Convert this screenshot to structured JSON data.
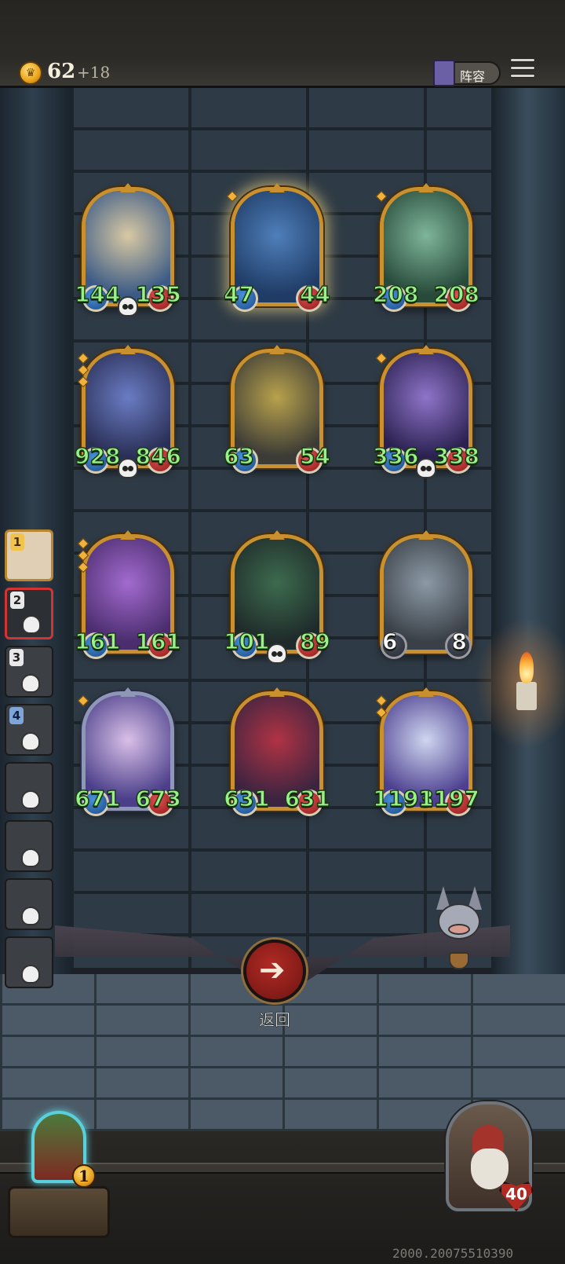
{
  "header": {
    "coin_count": "62",
    "coin_bonus": "+18",
    "lineup_label": "阵容"
  },
  "board": {
    "cards": [
      {
        "name": "king",
        "atk": "144",
        "hp": "135",
        "frame": "gold",
        "skull": true,
        "pips": 0,
        "art": [
          "#3b5a86",
          "#d8c9a3"
        ]
      },
      {
        "name": "jester-elf",
        "atk": "47",
        "hp": "44",
        "frame": "gold",
        "skull": false,
        "pips": 1,
        "selected": true,
        "art": [
          "#1f3c66",
          "#4f7fba"
        ]
      },
      {
        "name": "flute-maiden",
        "atk": "208",
        "hp": "208",
        "frame": "gold",
        "skull": false,
        "pips": 1,
        "art": [
          "#274a3a",
          "#7fb59a"
        ]
      },
      {
        "name": "blue-hair-sorceress",
        "atk": "928",
        "hp": "846",
        "frame": "gold",
        "skull": true,
        "pips": 3,
        "art": [
          "#2a2f55",
          "#6a7cc4"
        ]
      },
      {
        "name": "robot",
        "atk": "63",
        "hp": "54",
        "frame": "gold",
        "skull": false,
        "pips": 0,
        "art": [
          "#3c3b36",
          "#b8a24c"
        ]
      },
      {
        "name": "moon-witch",
        "atk": "336",
        "hp": "338",
        "frame": "gold",
        "skull": true,
        "pips": 1,
        "art": [
          "#2a2150",
          "#8f74c9"
        ]
      },
      {
        "name": "airship",
        "atk": "161",
        "hp": "161",
        "frame": "gold",
        "skull": false,
        "pips": 3,
        "art": [
          "#4b2d6e",
          "#a26bcf"
        ]
      },
      {
        "name": "tentacle-creature",
        "atk": "101",
        "hp": "89",
        "frame": "gold",
        "skull": true,
        "pips": 0,
        "art": [
          "#1f2a2a",
          "#3d6b4e"
        ]
      },
      {
        "name": "horned-beast",
        "atk": "6",
        "hp": "8",
        "frame": "gold",
        "skull": false,
        "pips": 0,
        "dark_badges": true,
        "white_stats": true,
        "art": [
          "#3a4047",
          "#8c9aa6"
        ]
      },
      {
        "name": "flower-fairy",
        "atk": "671",
        "hp": "673",
        "frame": "silver",
        "skull": false,
        "pips": 1,
        "art": [
          "#4b3f8a",
          "#d9c0e8"
        ]
      },
      {
        "name": "clown",
        "atk": "631",
        "hp": "631",
        "frame": "gold",
        "skull": false,
        "pips": 0,
        "art": [
          "#3b2440",
          "#b03344"
        ]
      },
      {
        "name": "snow-maiden",
        "atk": "1193",
        "hp": "1197",
        "frame": "gold",
        "skull": false,
        "pips": 2,
        "art": [
          "#4c3f8f",
          "#cfd6f0"
        ]
      }
    ]
  },
  "queue": {
    "slots": [
      {
        "number": "1",
        "style": "gold"
      },
      {
        "number": "2",
        "style": "red"
      },
      {
        "number": "3",
        "style": "plain"
      },
      {
        "number": "4",
        "style": "blue"
      },
      {
        "number": "",
        "style": "plain"
      },
      {
        "number": "",
        "style": "plain"
      },
      {
        "number": "",
        "style": "plain"
      },
      {
        "number": "",
        "style": "plain"
      }
    ]
  },
  "back_button": {
    "label": "返回"
  },
  "shop": {
    "count": "1"
  },
  "player": {
    "hp": "40"
  },
  "footer": {
    "build_number": "2000.20075510390"
  }
}
